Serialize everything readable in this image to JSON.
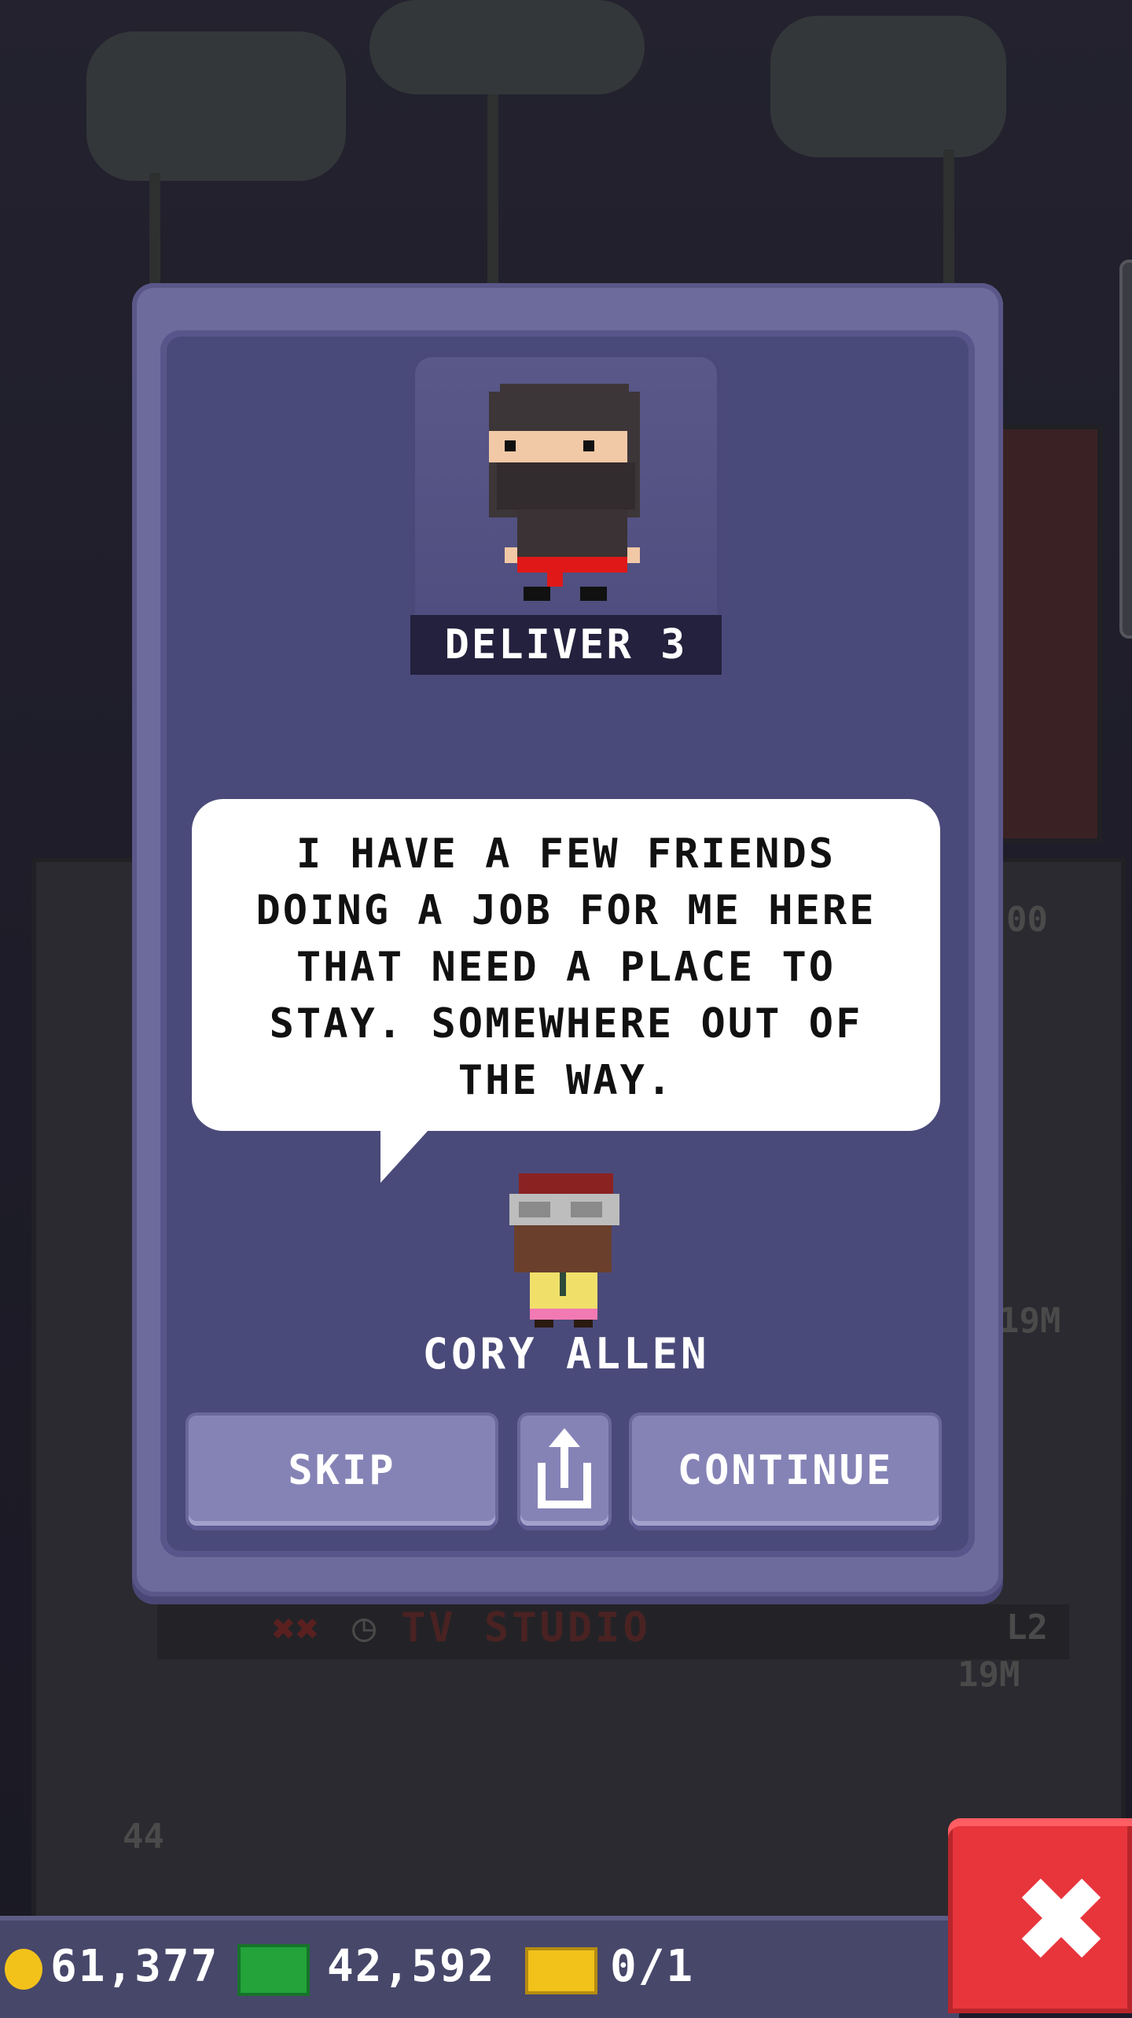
{
  "quest": {
    "task_label": "DELIVER 3",
    "dialogue": "I HAVE A FEW FRIENDS DOING A JOB FOR ME HERE THAT NEED A PLACE TO STAY. SOMEWHERE OUT OF THE WAY.",
    "speaker_name": "CORY ALLEN"
  },
  "buttons": {
    "skip_label": "SKIP",
    "share_icon": "share-icon",
    "continue_label": "CONTINUE"
  },
  "background": {
    "floor_name": "TV STUDIO",
    "floor_level": "L2",
    "floor_income": "19M",
    "floor_income_upper": "19M",
    "floor_number": "44",
    "partial_value": "00"
  },
  "status_bar": {
    "coins": "61,377",
    "bux": "42,592",
    "tickets": "0/1"
  },
  "colors": {
    "dialog_frame": "#6d6a9c",
    "dialog_inner": "#4a4a7a",
    "button": "#8583b6",
    "close_red": "#e8353c",
    "coin_gold": "#f2c21b",
    "bux_green": "#23a33a"
  }
}
